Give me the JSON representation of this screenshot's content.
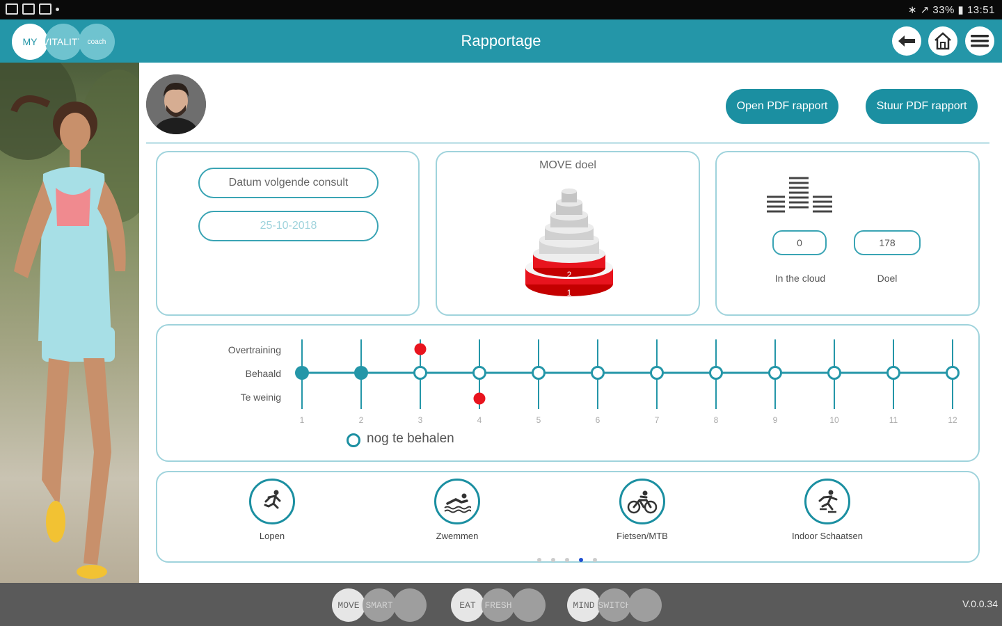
{
  "status": {
    "right": "∗ ↗ 33% ▮ 13:51"
  },
  "header": {
    "logo": [
      "MY",
      "VITALITY",
      "coach"
    ],
    "title": "Rapportage"
  },
  "actions": {
    "open_pdf": "Open PDF rapport",
    "send_pdf": "Stuur PDF rapport"
  },
  "consult": {
    "label": "Datum volgende consult",
    "date": "25-10-2018"
  },
  "move_goal": {
    "title": "MOVE doel",
    "levels": [
      "1",
      "2",
      "3",
      "4",
      "5",
      "6"
    ],
    "achieved_levels": 2
  },
  "cloud": {
    "in_cloud_value": "0",
    "goal_value": "178",
    "in_cloud_label": "In the cloud",
    "goal_label": "Doel"
  },
  "progress": {
    "row_labels": [
      "Overtraining",
      "Behaald",
      "Te weinig"
    ],
    "weeks": [
      "1",
      "2",
      "3",
      "4",
      "5",
      "6",
      "7",
      "8",
      "9",
      "10",
      "11",
      "12"
    ],
    "legend": "nog te behalen",
    "states": [
      "behaald",
      "behaald",
      "overtraining",
      "te-weinig",
      "open",
      "open",
      "open",
      "open",
      "open",
      "open",
      "open",
      "open"
    ]
  },
  "activities": [
    {
      "name": "Lopen",
      "icon": "running-icon"
    },
    {
      "name": "Zwemmen",
      "icon": "swimming-icon"
    },
    {
      "name": "Fietsen/MTB",
      "icon": "cycling-icon"
    },
    {
      "name": "Indoor Schaatsen",
      "icon": "skating-icon"
    }
  ],
  "pager": {
    "pages": 5,
    "current": 4
  },
  "bottom_nav": [
    [
      "MOVE",
      "SMART",
      ""
    ],
    [
      "EAT",
      "FRESH",
      ""
    ],
    [
      "MIND",
      "SWITCH",
      ""
    ]
  ],
  "version": "V.0.0.34",
  "colors": {
    "primary": "#2496a8",
    "accent_red": "#e8141e",
    "outline": "#9fd3dc"
  }
}
